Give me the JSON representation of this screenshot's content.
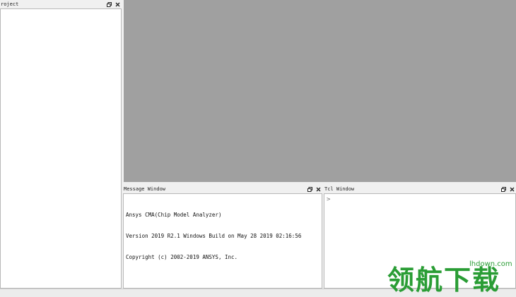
{
  "project_window": {
    "title": "roject"
  },
  "message_window": {
    "title": "Message Window",
    "lines": [
      "Ansys CMA(Chip Model Analyzer)",
      "Version 2019 R2.1 Windows Build on May 28 2019 02:16:56",
      "Copyright (c) 2002-2019 ANSYS, Inc."
    ]
  },
  "tcl_window": {
    "title": "Tcl Window",
    "prompt": ">"
  },
  "watermark": {
    "text": "领航下载",
    "url": "lhdown.com"
  },
  "colors": {
    "workspace": "#a0a0a0",
    "watermark": "#2a9d35"
  },
  "icons": [
    "float-icon",
    "close-icon"
  ]
}
